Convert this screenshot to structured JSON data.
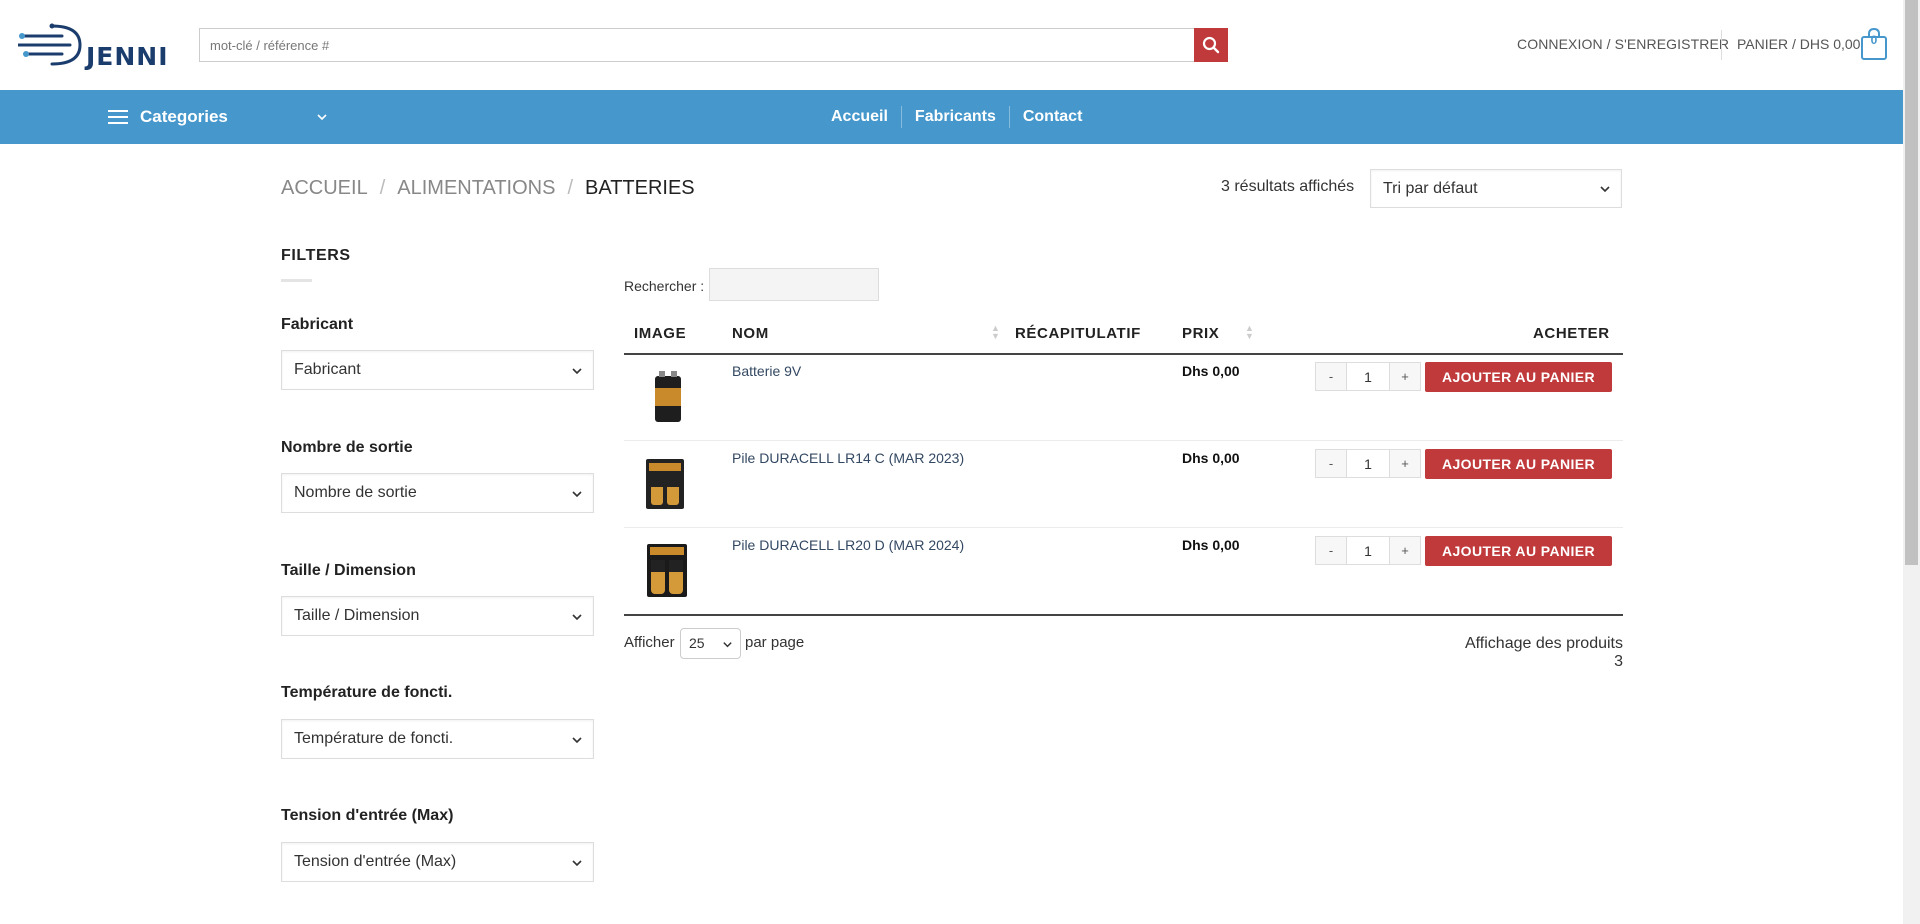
{
  "header": {
    "logo_text": "JENNI",
    "search_placeholder": "mot-clé / référence #",
    "login_label": "CONNEXION / S'ENREGISTRER",
    "cart_label": "PANIER / DHS 0,00",
    "cart_count": "0",
    "accent_color": "#c0393b",
    "nav_color": "#4597cc"
  },
  "nav": {
    "categories_label": "Categories",
    "links": [
      "Accueil",
      "Fabricants",
      "Contact"
    ]
  },
  "breadcrumb": {
    "items": [
      "ACCUEIL",
      "ALIMENTATIONS"
    ],
    "current": "BATTERIES"
  },
  "results": {
    "count_text": "3 résultats affichés",
    "sort_selected": "Tri par défaut"
  },
  "filters": {
    "title": "FILTERS",
    "groups": [
      {
        "label": "Fabricant",
        "selected": "Fabricant"
      },
      {
        "label": "Nombre de sortie",
        "selected": "Nombre de sortie"
      },
      {
        "label": "Taille / Dimension",
        "selected": "Taille / Dimension"
      },
      {
        "label": "Température de foncti.",
        "selected": "Température de foncti."
      },
      {
        "label": "Tension d'entrée (Max)",
        "selected": "Tension d'entrée (Max)"
      }
    ]
  },
  "table": {
    "search_label": "Rechercher :",
    "columns": [
      "IMAGE",
      "NOM",
      "RÉCAPITULATIF",
      "PRIX",
      "ACHETER"
    ],
    "rows": [
      {
        "name": "Batterie 9V",
        "price": "Dhs 0,00",
        "qty": "1",
        "image_icon": "battery-9v-image"
      },
      {
        "name": "Pile DURACELL LR14 C (MAR 2023)",
        "price": "Dhs 0,00",
        "qty": "1",
        "image_icon": "duracell-c-image"
      },
      {
        "name": "Pile DURACELL LR20 D (MAR 2024)",
        "price": "Dhs 0,00",
        "qty": "1",
        "image_icon": "duracell-d-image"
      }
    ],
    "add_label": "AJOUTER AU PANIER",
    "qty_minus": "-",
    "qty_plus": "+"
  },
  "pagination": {
    "show_label": "Afficher",
    "per_page_value": "25",
    "per_page_label": "par page",
    "info": "Affichage des produits 3"
  }
}
